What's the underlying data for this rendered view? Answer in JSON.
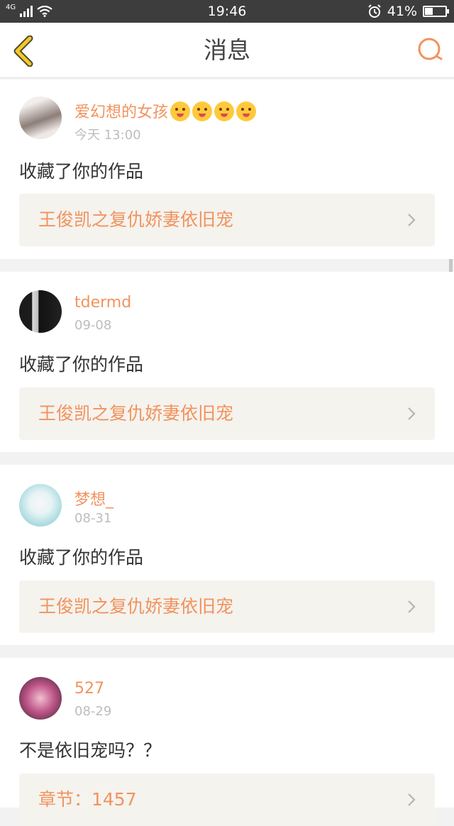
{
  "status_bar": {
    "network": "4G",
    "time": "19:46",
    "battery_text": "41%",
    "battery_level": 0.41
  },
  "nav": {
    "title": "消息"
  },
  "messages": [
    {
      "username": "爱幻想的女孩",
      "date": "今天 13:00",
      "text": "收藏了你的作品",
      "work": "王俊凯之复仇娇妻依旧宠",
      "avatar_colors": [
        "#e8e4e2",
        "#6a5a56"
      ]
    },
    {
      "username": "tdermd",
      "date": "09-08",
      "text": "收藏了你的作品",
      "work": "王俊凯之复仇娇妻依旧宠",
      "avatar_colors": [
        "#d8d8d8",
        "#1a1a1a"
      ]
    },
    {
      "username": "梦想_",
      "date": "08-31",
      "text": "收藏了你的作品",
      "work": "王俊凯之复仇娇妻依旧宠",
      "avatar_colors": [
        "#cfeef2",
        "#9ad1d8"
      ]
    },
    {
      "username": "527",
      "date": "08-29",
      "text": "不是依旧宠吗？？",
      "work": "章节：1457",
      "avatar_colors": [
        "#c15a8d",
        "#3a2030"
      ]
    }
  ],
  "colors": {
    "accent": "#f1935e",
    "back_icon": "#f5c72a"
  },
  "icons": {
    "back": "chevron-left-icon",
    "search": "search-icon",
    "row_arrow": "chevron-right-icon"
  }
}
